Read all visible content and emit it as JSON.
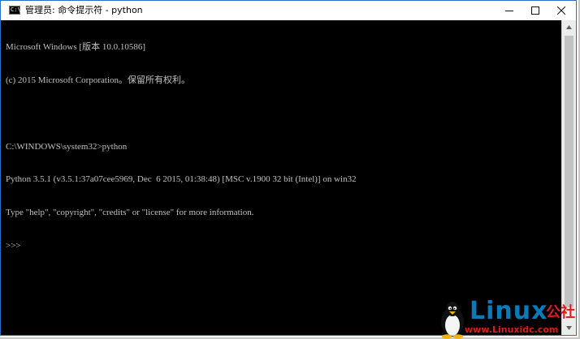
{
  "window": {
    "title": "管理员: 命令提示符 - python",
    "icon_label": "C:\\",
    "controls": {
      "minimize": "minimize-icon",
      "maximize": "maximize-icon",
      "close": "close-icon"
    }
  },
  "console": {
    "lines": [
      "Microsoft Windows [版本 10.0.10586]",
      "(c) 2015 Microsoft Corporation。保留所有权利。",
      "",
      "C:\\WINDOWS\\system32>python",
      "Python 3.5.1 (v3.5.1:37a07cee5969, Dec  6 2015, 01:38:48) [MSC v.1900 32 bit (Intel)] on win32",
      "Type \"help\", \"copyright\", \"credits\" or \"license\" for more information.",
      ">>>"
    ],
    "text_color": "#c0c0c0",
    "background": "#000000"
  },
  "watermark": {
    "brand": "Linux",
    "suffix": "公社",
    "url": "www.Linuxidc.com"
  }
}
